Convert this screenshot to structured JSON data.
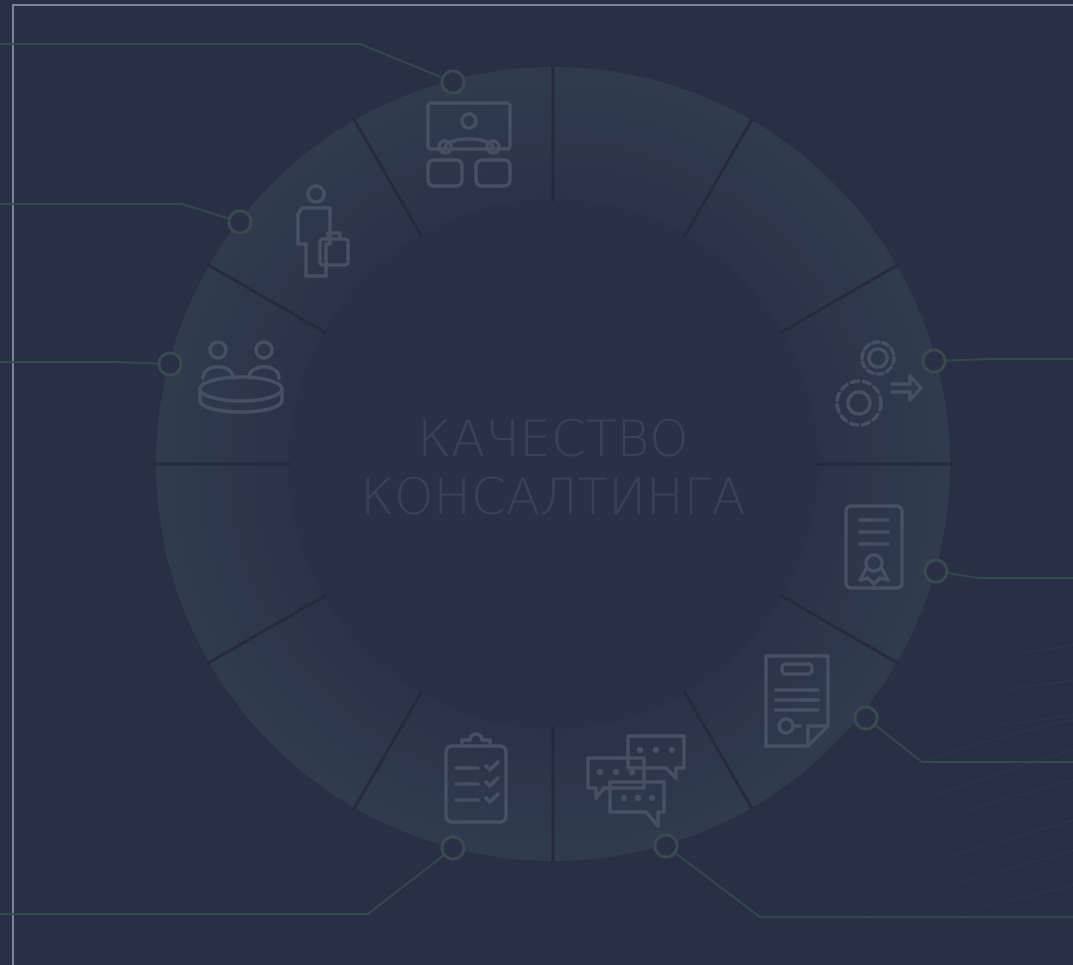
{
  "diagram": {
    "center_title_line1": "КАЧЕСТВО",
    "center_title_line2": "КОНСАЛТИНГА",
    "segments": [
      {
        "icon": "presentation-meeting-icon"
      },
      {
        "icon": "blank"
      },
      {
        "icon": "blank"
      },
      {
        "icon": "gears-arrow-icon"
      },
      {
        "icon": "certificate-icon"
      },
      {
        "icon": "document-contract-icon"
      },
      {
        "icon": "chat-bubbles-icon"
      },
      {
        "icon": "checklist-clipboard-icon"
      },
      {
        "icon": "blank"
      },
      {
        "icon": "blank"
      },
      {
        "icon": "round-table-meeting-icon"
      },
      {
        "icon": "businessman-briefcase-icon"
      }
    ]
  },
  "colors": {
    "background": "#292f45",
    "ring": "#2f3a4c",
    "ring_inner": "#2c3248",
    "ring_divider": "#252b3d",
    "icon_stroke": "#474f63",
    "connector": "#36484f",
    "accent_tick": "#4fd08f",
    "frame": "#7e8497",
    "title": "#3b4256"
  }
}
